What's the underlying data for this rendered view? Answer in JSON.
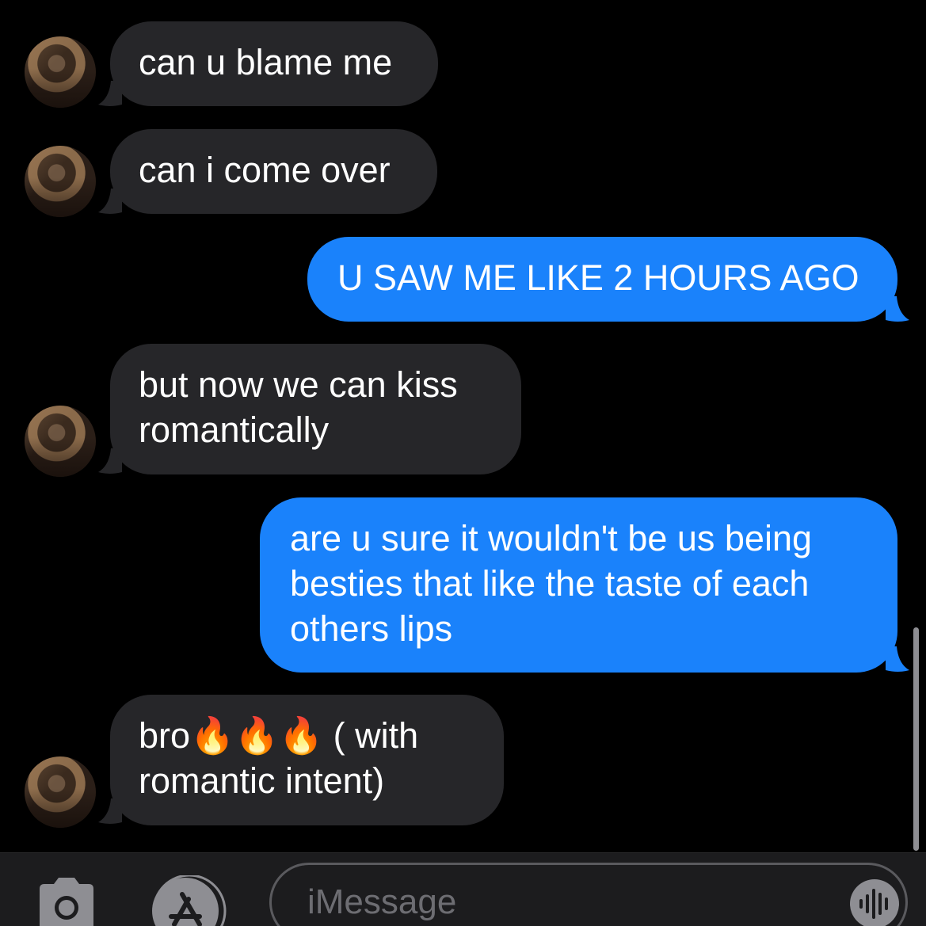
{
  "conversation": {
    "messages": [
      {
        "sender": "them",
        "text": "can u blame me"
      },
      {
        "sender": "them",
        "text": "can i come over"
      },
      {
        "sender": "me",
        "text": "U SAW ME LIKE 2 HOURS AGO"
      },
      {
        "sender": "them",
        "lines": [
          "but now we can kiss",
          "romantically"
        ]
      },
      {
        "sender": "me",
        "lines": [
          "are u sure it wouldn't be us being",
          "besties that like the taste of each",
          "others lips"
        ]
      },
      {
        "sender": "them",
        "lines": [
          "bro🔥🔥🔥 ( with",
          "romantic intent)"
        ]
      }
    ]
  },
  "composer": {
    "placeholder": "iMessage",
    "icons": [
      "camera-icon",
      "app-store-icon",
      "audio-waveform-icon"
    ]
  },
  "colors": {
    "background": "#000000",
    "incoming_bubble": "#262629",
    "outgoing_bubble": "#1a82fb",
    "toolbar": "#1c1c1e"
  }
}
